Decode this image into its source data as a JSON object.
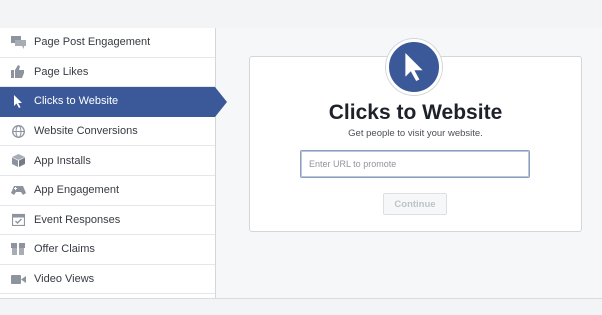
{
  "colors": {
    "accent": "#3b5998",
    "sidebar_active_text": "#ffffff"
  },
  "sidebar": {
    "items": [
      {
        "label": "Page Post Engagement",
        "icon": "speech-bubbles-icon",
        "active": false
      },
      {
        "label": "Page Likes",
        "icon": "thumbs-up-icon",
        "active": false
      },
      {
        "label": "Clicks to Website",
        "icon": "cursor-arrow-icon",
        "active": true
      },
      {
        "label": "Website Conversions",
        "icon": "globe-icon",
        "active": false
      },
      {
        "label": "App Installs",
        "icon": "box-icon",
        "active": false
      },
      {
        "label": "App Engagement",
        "icon": "gamepad-icon",
        "active": false
      },
      {
        "label": "Event Responses",
        "icon": "calendar-check-icon",
        "active": false
      },
      {
        "label": "Offer Claims",
        "icon": "offer-tag-icon",
        "active": false
      },
      {
        "label": "Video Views",
        "icon": "video-camera-icon",
        "active": false
      }
    ]
  },
  "main": {
    "hero_icon": "cursor-arrow-icon",
    "title": "Clicks to Website",
    "subtitle": "Get people to visit your website.",
    "url_input": {
      "value": "",
      "placeholder": "Enter URL to promote"
    },
    "continue_label": "Continue"
  }
}
